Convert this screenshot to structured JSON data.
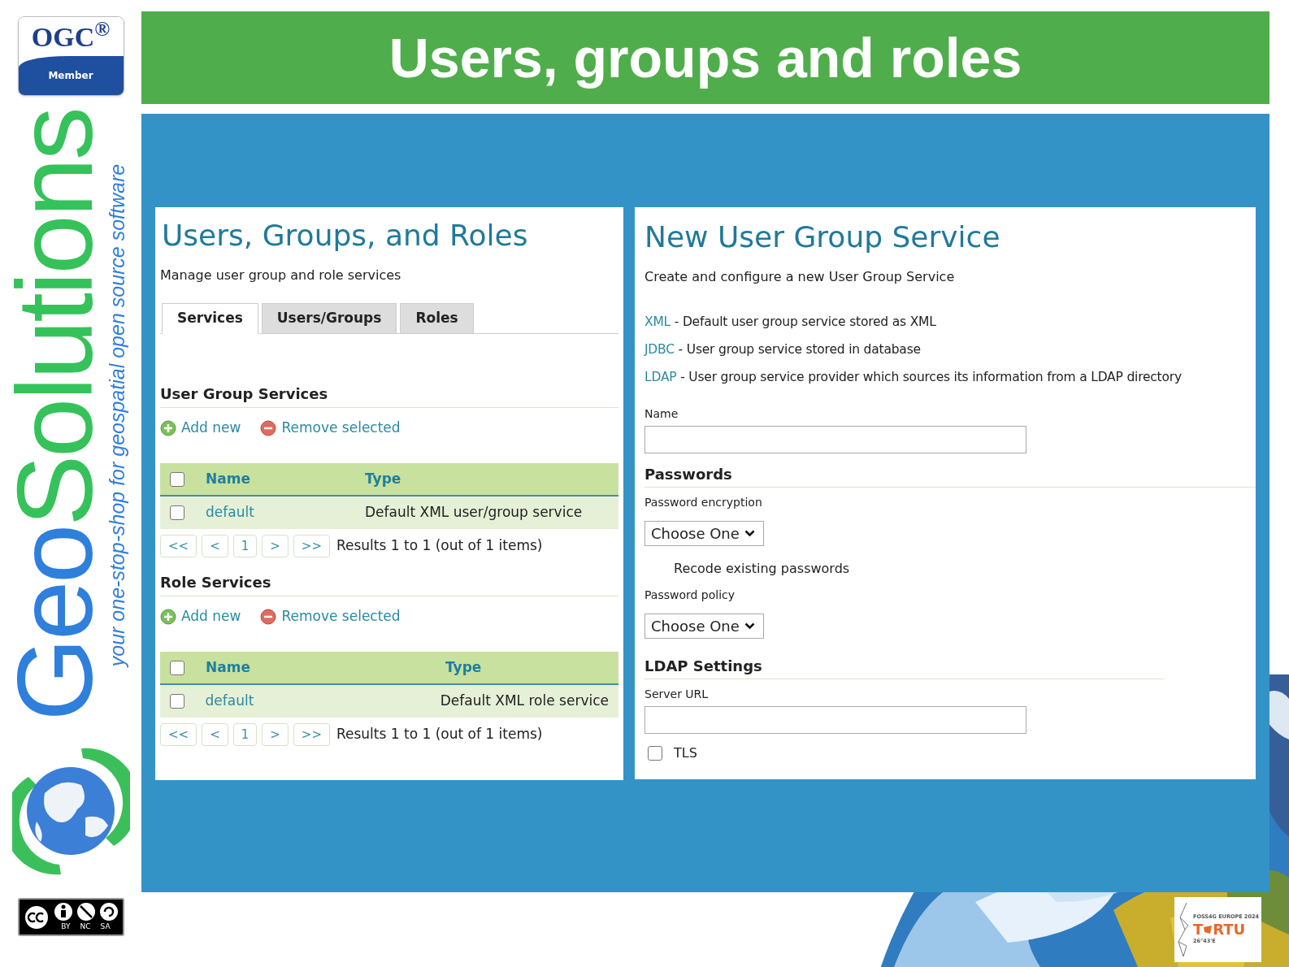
{
  "sidebar": {
    "ogc_logo": {
      "text": "OGC$^{®}$",
      "caption": "Member"
    },
    "brand_parts": [
      "Geo",
      "Solutions"
    ],
    "tagline": "your one-stop-shop for geospatial open source software",
    "license_labels": [
      "BY",
      "NC",
      "SA"
    ]
  },
  "slide_title": "Users, groups and roles",
  "left_panel": {
    "title": "Users, Groups, and Roles",
    "subtitle": "Manage user group and role services",
    "tabs": [
      {
        "label": "Services",
        "selected": true
      },
      {
        "label": "Users/Groups",
        "selected": false
      },
      {
        "label": "Roles",
        "selected": false
      }
    ],
    "sections": [
      {
        "heading": "User Group Services",
        "actions": [
          {
            "kind": "add",
            "label": "Add new"
          },
          {
            "kind": "remove",
            "label": "Remove selected"
          }
        ],
        "columns": [
          {
            "label": "Name"
          },
          {
            "label": "Type"
          }
        ],
        "header_checked": false,
        "rows": [
          {
            "checked": false,
            "name": "default",
            "type": "Default XML user/group service"
          }
        ],
        "pager": [
          "<<",
          "<",
          "1",
          ">",
          ">>"
        ],
        "results": "Results 1 to 1 (out of 1 items)"
      },
      {
        "heading": "Role Services",
        "actions": [
          {
            "kind": "add",
            "label": "Add new"
          },
          {
            "kind": "remove",
            "label": "Remove selected"
          }
        ],
        "columns": [
          {
            "label": "Name"
          },
          {
            "label": "Type"
          }
        ],
        "header_checked": false,
        "rows": [
          {
            "checked": false,
            "name": "default",
            "type": "Default XML role service"
          }
        ],
        "pager": [
          "<<",
          "<",
          "1",
          ">",
          ">>"
        ],
        "results": "Results 1 to 1 (out of 1 items)"
      }
    ]
  },
  "right_panel": {
    "title": "New User Group Service",
    "subtitle": "Create and configure a new User Group Service",
    "service_types": [
      {
        "link": "XML",
        "description": " - Default user group service stored as XML"
      },
      {
        "link": "JDBC",
        "description": " - User group service stored in database"
      },
      {
        "link": "LDAP",
        "description": " - User group service provider which sources its information from a LDAP directory"
      }
    ],
    "name_label": "Name",
    "passwords_heading": "Passwords",
    "encryption_label": "Password encryption",
    "encryption_value": "Choose One",
    "recode_label": "Recode existing passwords",
    "policy_label": "Password policy",
    "policy_value": "Choose One",
    "ldap_heading": "LDAP Settings",
    "server_url_label": "Server URL",
    "tls": {
      "label": "TLS",
      "checked": false
    }
  },
  "event_logo": {
    "line1": "FOSS4G EUROPE 2024",
    "name_parts": [
      "T",
      "RTU"
    ],
    "coords": "26°43'E"
  }
}
